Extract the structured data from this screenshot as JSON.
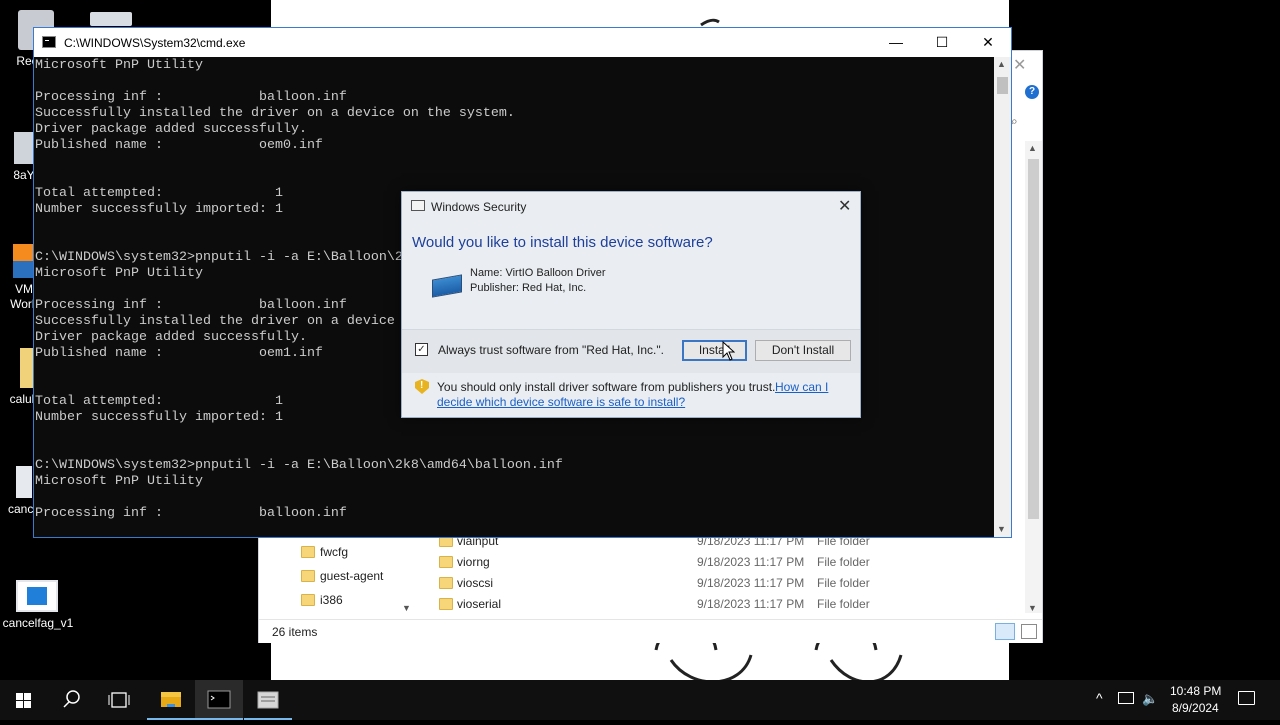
{
  "desktop": {
    "icons": [
      {
        "label": "Recy",
        "icon": "recycle-bin-icon"
      },
      {
        "label": "8aY",
        "icon": "app-icon"
      },
      {
        "label": "VM Work",
        "icon": "vmware-icon"
      },
      {
        "label": "calub",
        "icon": "folder-icon"
      },
      {
        "label": "cance",
        "icon": "file-icon"
      },
      {
        "label": "cancelfag_v1",
        "icon": "window-icon"
      }
    ]
  },
  "cmd": {
    "title": "C:\\WINDOWS\\System32\\cmd.exe",
    "lines": [
      "Microsoft PnP Utility",
      "",
      "Processing inf :            balloon.inf",
      "Successfully installed the driver on a device on the system.",
      "Driver package added successfully.",
      "Published name :            oem0.inf",
      "",
      "",
      "Total attempted:              1",
      "Number successfully imported: 1",
      "",
      "",
      "C:\\WINDOWS\\system32>pnputil -i -a E:\\Balloon\\2k3\\x86\\balloon.inf",
      "Microsoft PnP Utility",
      "",
      "Processing inf :            balloon.inf",
      "Successfully installed the driver on a device on the system.",
      "Driver package added successfully.",
      "Published name :            oem1.inf",
      "",
      "",
      "Total attempted:              1",
      "Number successfully imported: 1",
      "",
      "",
      "C:\\WINDOWS\\system32>pnputil -i -a E:\\Balloon\\2k8\\amd64\\balloon.inf",
      "Microsoft PnP Utility",
      "",
      "Processing inf :            balloon.inf"
    ]
  },
  "dialog": {
    "title": "Windows Security",
    "question": "Would you like to install this device software?",
    "name": "Name: VirtIO Balloon Driver",
    "publisher": "Publisher: Red Hat, Inc.",
    "always_trust": "Always trust software from \"Red Hat, Inc.\".",
    "always_trust_checked": true,
    "install_label": "Install",
    "dont_install_label": "Don't Install",
    "warning": "You should only install driver software from publishers you trust.",
    "link1": "How can I",
    "link2": "decide which device software is safe to install?"
  },
  "explorer": {
    "nav_items": [
      "fwcfg",
      "guest-agent",
      "i386"
    ],
    "files": [
      {
        "name": "viainput",
        "date": "9/18/2023 11:17 PM",
        "type": "File folder"
      },
      {
        "name": "viorng",
        "date": "9/18/2023 11:17 PM",
        "type": "File folder"
      },
      {
        "name": "vioscsi",
        "date": "9/18/2023 11:17 PM",
        "type": "File folder"
      },
      {
        "name": "vioserial",
        "date": "9/18/2023 11:17 PM",
        "type": "File folder"
      }
    ],
    "status": "26 items"
  },
  "taskbar": {
    "time": "10:48 PM",
    "date": "8/9/2024"
  }
}
